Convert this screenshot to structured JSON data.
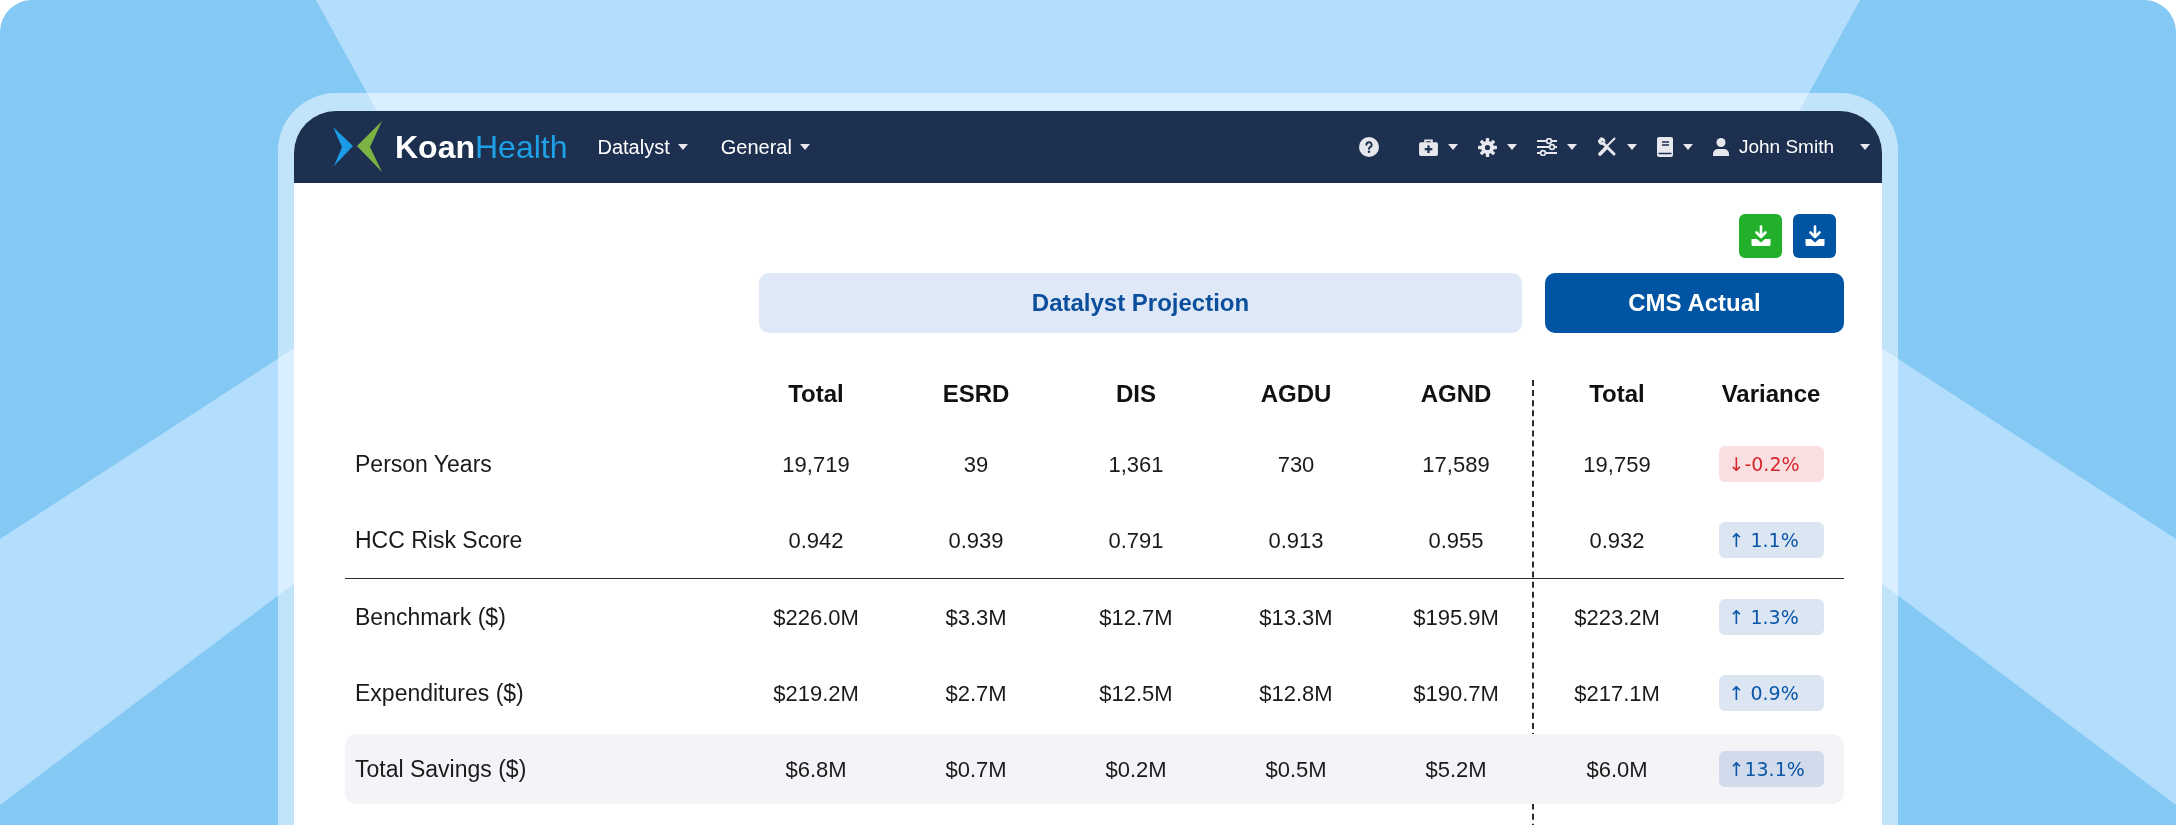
{
  "navbar": {
    "logo": {
      "primary": "Koan",
      "secondary": "Health"
    },
    "menus": [
      {
        "label": "Datalyst"
      },
      {
        "label": "General"
      }
    ],
    "user": {
      "name": "John Smith"
    }
  },
  "export_buttons": [
    {
      "color": "#22b02a"
    },
    {
      "color": "#0054a4"
    }
  ],
  "column_groups": [
    {
      "label": "Datalyst Projection",
      "kind": "projection"
    },
    {
      "label": "CMS Actual",
      "kind": "actual"
    }
  ],
  "table": {
    "columns": [
      "Total",
      "ESRD",
      "DIS",
      "AGDU",
      "AGND",
      "Total",
      "Variance"
    ],
    "sections": [
      {
        "rows": [
          {
            "label": "Person Years",
            "cells": [
              "19,719",
              "39",
              "1,361",
              "730",
              "17,589",
              "19,759"
            ],
            "variance": {
              "text": "↓-0.2%",
              "color": "#d7262c"
            },
            "highlighted": false
          },
          {
            "label": "HCC Risk Score",
            "cells": [
              "0.942",
              "0.939",
              "0.791",
              "0.913",
              "0.955",
              "0.932"
            ],
            "variance": {
              "text": "↑ 1.1%",
              "color": "#0b56a8"
            },
            "highlighted": false
          }
        ]
      },
      {
        "rows": [
          {
            "label": "Benchmark ($)",
            "cells": [
              "$226.0M",
              "$3.3M",
              "$12.7M",
              "$13.3M",
              "$195.9M",
              "$223.2M"
            ],
            "variance": {
              "text": "↑ 1.3%",
              "color": "#0b56a8"
            },
            "highlighted": false
          },
          {
            "label": "Expenditures ($)",
            "cells": [
              "$219.2M",
              "$2.7M",
              "$12.5M",
              "$12.8M",
              "$190.7M",
              "$217.1M"
            ],
            "variance": {
              "text": "↑ 0.9%",
              "color": "#0b56a8"
            },
            "highlighted": false
          },
          {
            "label": "Total Savings ($)",
            "cells": [
              "$6.8M",
              "$0.7M",
              "$0.2M",
              "$0.5M",
              "$5.2M",
              "$6.0M"
            ],
            "variance": {
              "text": "↑13.1%",
              "color": "#0b56a8"
            },
            "highlighted": true
          }
        ]
      }
    ]
  }
}
